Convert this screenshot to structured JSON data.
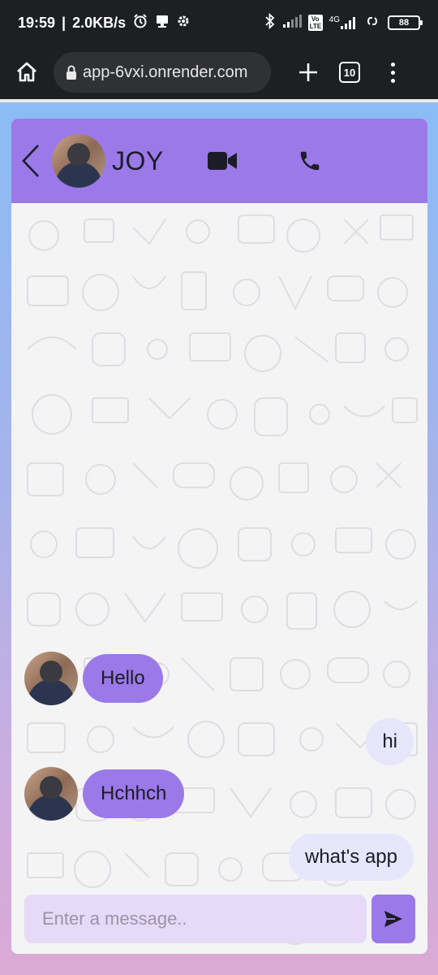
{
  "status_bar": {
    "time": "19:59",
    "net_speed": "2.0KB/s",
    "network_label": "4G",
    "volte_label": "Vo LTE",
    "battery": "88"
  },
  "browser": {
    "url": "app-6vxi.onrender.com",
    "tab_count": "10"
  },
  "chat": {
    "contact_name": "JOY",
    "messages": [
      {
        "direction": "incoming",
        "text": "Hello"
      },
      {
        "direction": "outgoing",
        "text": "hi"
      },
      {
        "direction": "incoming",
        "text": "Hchhch"
      },
      {
        "direction": "outgoing",
        "text": "what's app"
      }
    ],
    "composer": {
      "placeholder": "Enter a message.."
    }
  },
  "colors": {
    "accent": "#9b79e8",
    "outgoing_bubble": "#e7e6fb",
    "input_bg": "#e6daf8",
    "page_gradient_top": "#8bbcf5",
    "page_gradient_bottom": "#dba9d4"
  }
}
